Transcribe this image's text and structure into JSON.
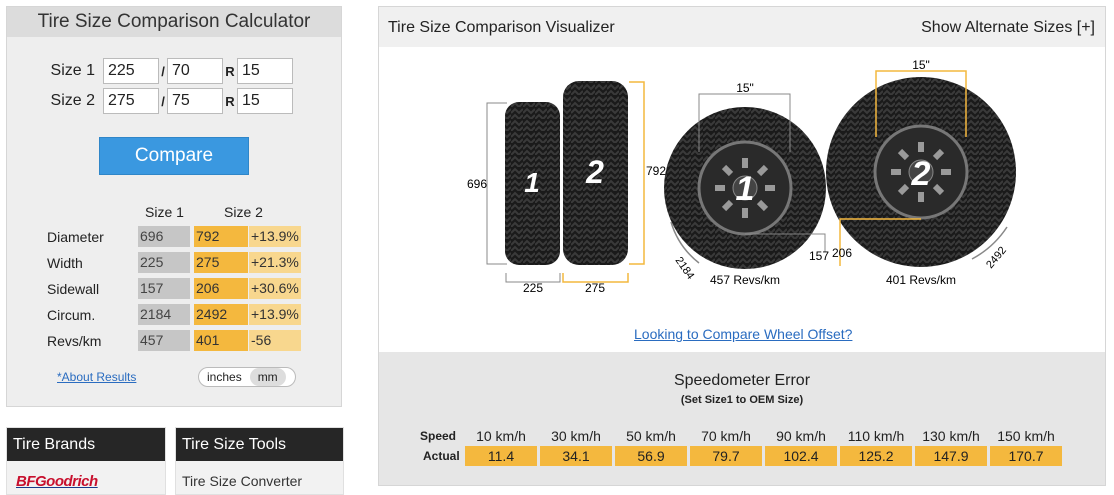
{
  "calculator": {
    "title": "Tire Size Comparison Calculator",
    "size1": {
      "label": "Size 1",
      "width": "225",
      "aspect": "70",
      "r_label": "R",
      "rim": "15"
    },
    "size2": {
      "label": "Size 2",
      "width": "275",
      "aspect": "75",
      "r_label": "R",
      "rim": "15"
    },
    "slash": "/",
    "compare_label": "Compare",
    "results": {
      "col1": "Size 1",
      "col2": "Size 2",
      "rows": [
        {
          "label": "Diameter",
          "v1": "696",
          "v2": "792",
          "diff": "+13.9%"
        },
        {
          "label": "Width",
          "v1": "225",
          "v2": "275",
          "diff": "+21.3%"
        },
        {
          "label": "Sidewall",
          "v1": "157",
          "v2": "206",
          "diff": "+30.6%"
        },
        {
          "label": "Circum.",
          "v1": "2184",
          "v2": "2492",
          "diff": "+13.9%"
        },
        {
          "label": "Revs/km",
          "v1": "457",
          "v2": "401",
          "diff": "-56"
        }
      ]
    },
    "about_link": "*About Results",
    "units": {
      "inches": "inches",
      "mm": "mm",
      "selected": "mm"
    }
  },
  "sidebar": {
    "brands_title": "Tire Brands",
    "brand_logo": "BFGoodrich",
    "tools_title": "Tire Size Tools",
    "tools_first": "Tire Size Converter"
  },
  "visualizer": {
    "title": "Tire Size Comparison Visualizer",
    "alt_link": "Show Alternate Sizes [+]",
    "side": {
      "num1": "1",
      "num2": "2",
      "dia1": "696",
      "dia2": "792",
      "w1": "225",
      "w2": "275"
    },
    "wheel1": {
      "num": "1",
      "rim": "15\"",
      "circ": "2184",
      "sidewall": "157",
      "revs": "457 Revs/km"
    },
    "wheel2": {
      "num": "2",
      "rim": "15\"",
      "circ": "2492",
      "sidewall": "206",
      "revs": "401 Revs/km"
    },
    "offset_link": "Looking to Compare Wheel Offset?"
  },
  "speedometer": {
    "title": "Speedometer Error",
    "subtitle": "(Set Size1 to OEM Size)",
    "speed_label": "Speed",
    "actual_label": "Actual",
    "speeds": [
      "10 km/h",
      "30 km/h",
      "50 km/h",
      "70 km/h",
      "90 km/h",
      "110 km/h",
      "130 km/h",
      "150 km/h"
    ],
    "actual": [
      "11.4",
      "34.1",
      "56.9",
      "79.7",
      "102.4",
      "125.2",
      "147.9",
      "170.7"
    ]
  },
  "colors": {
    "accent": "#3a98e0",
    "orange": "#f4b83e",
    "light_orange": "#f8d78e",
    "gray": "#c6c6c6"
  }
}
